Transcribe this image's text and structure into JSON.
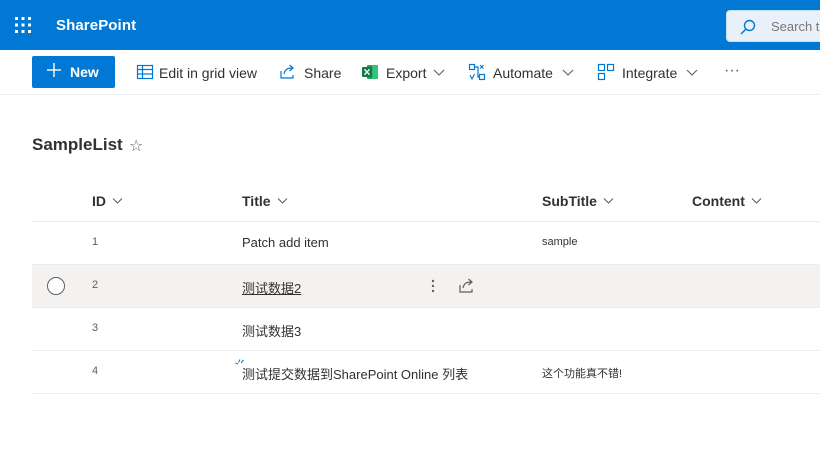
{
  "suitebar": {
    "brand": "SharePoint",
    "search_placeholder": "Search t",
    "accent": "#0078d4"
  },
  "commandbar": {
    "new_label": "New",
    "edit_grid_label": "Edit in grid view",
    "share_label": "Share",
    "export_label": "Export",
    "automate_label": "Automate",
    "integrate_label": "Integrate",
    "more_label": "···"
  },
  "list": {
    "title": "SampleList",
    "star": "☆",
    "columns": {
      "id": "ID",
      "title": "Title",
      "subtitle": "SubTitle",
      "content": "Content"
    },
    "rows": [
      {
        "id": "1",
        "title": "Patch add item",
        "subtitle": "sample"
      },
      {
        "id": "2",
        "title": "测试数据2",
        "subtitle": ""
      },
      {
        "id": "3",
        "title": "测试数据3",
        "subtitle": ""
      },
      {
        "id": "4",
        "title": "测试提交数据到SharePoint Online 列表",
        "subtitle": "这个功能真不错!"
      }
    ]
  },
  "icons": {
    "waffle": "app-launcher-icon",
    "search": "search-icon",
    "grid": "grid-view-icon",
    "share": "share-icon",
    "excel": "excel-icon",
    "automate": "automate-icon",
    "integrate": "integrate-icon"
  }
}
